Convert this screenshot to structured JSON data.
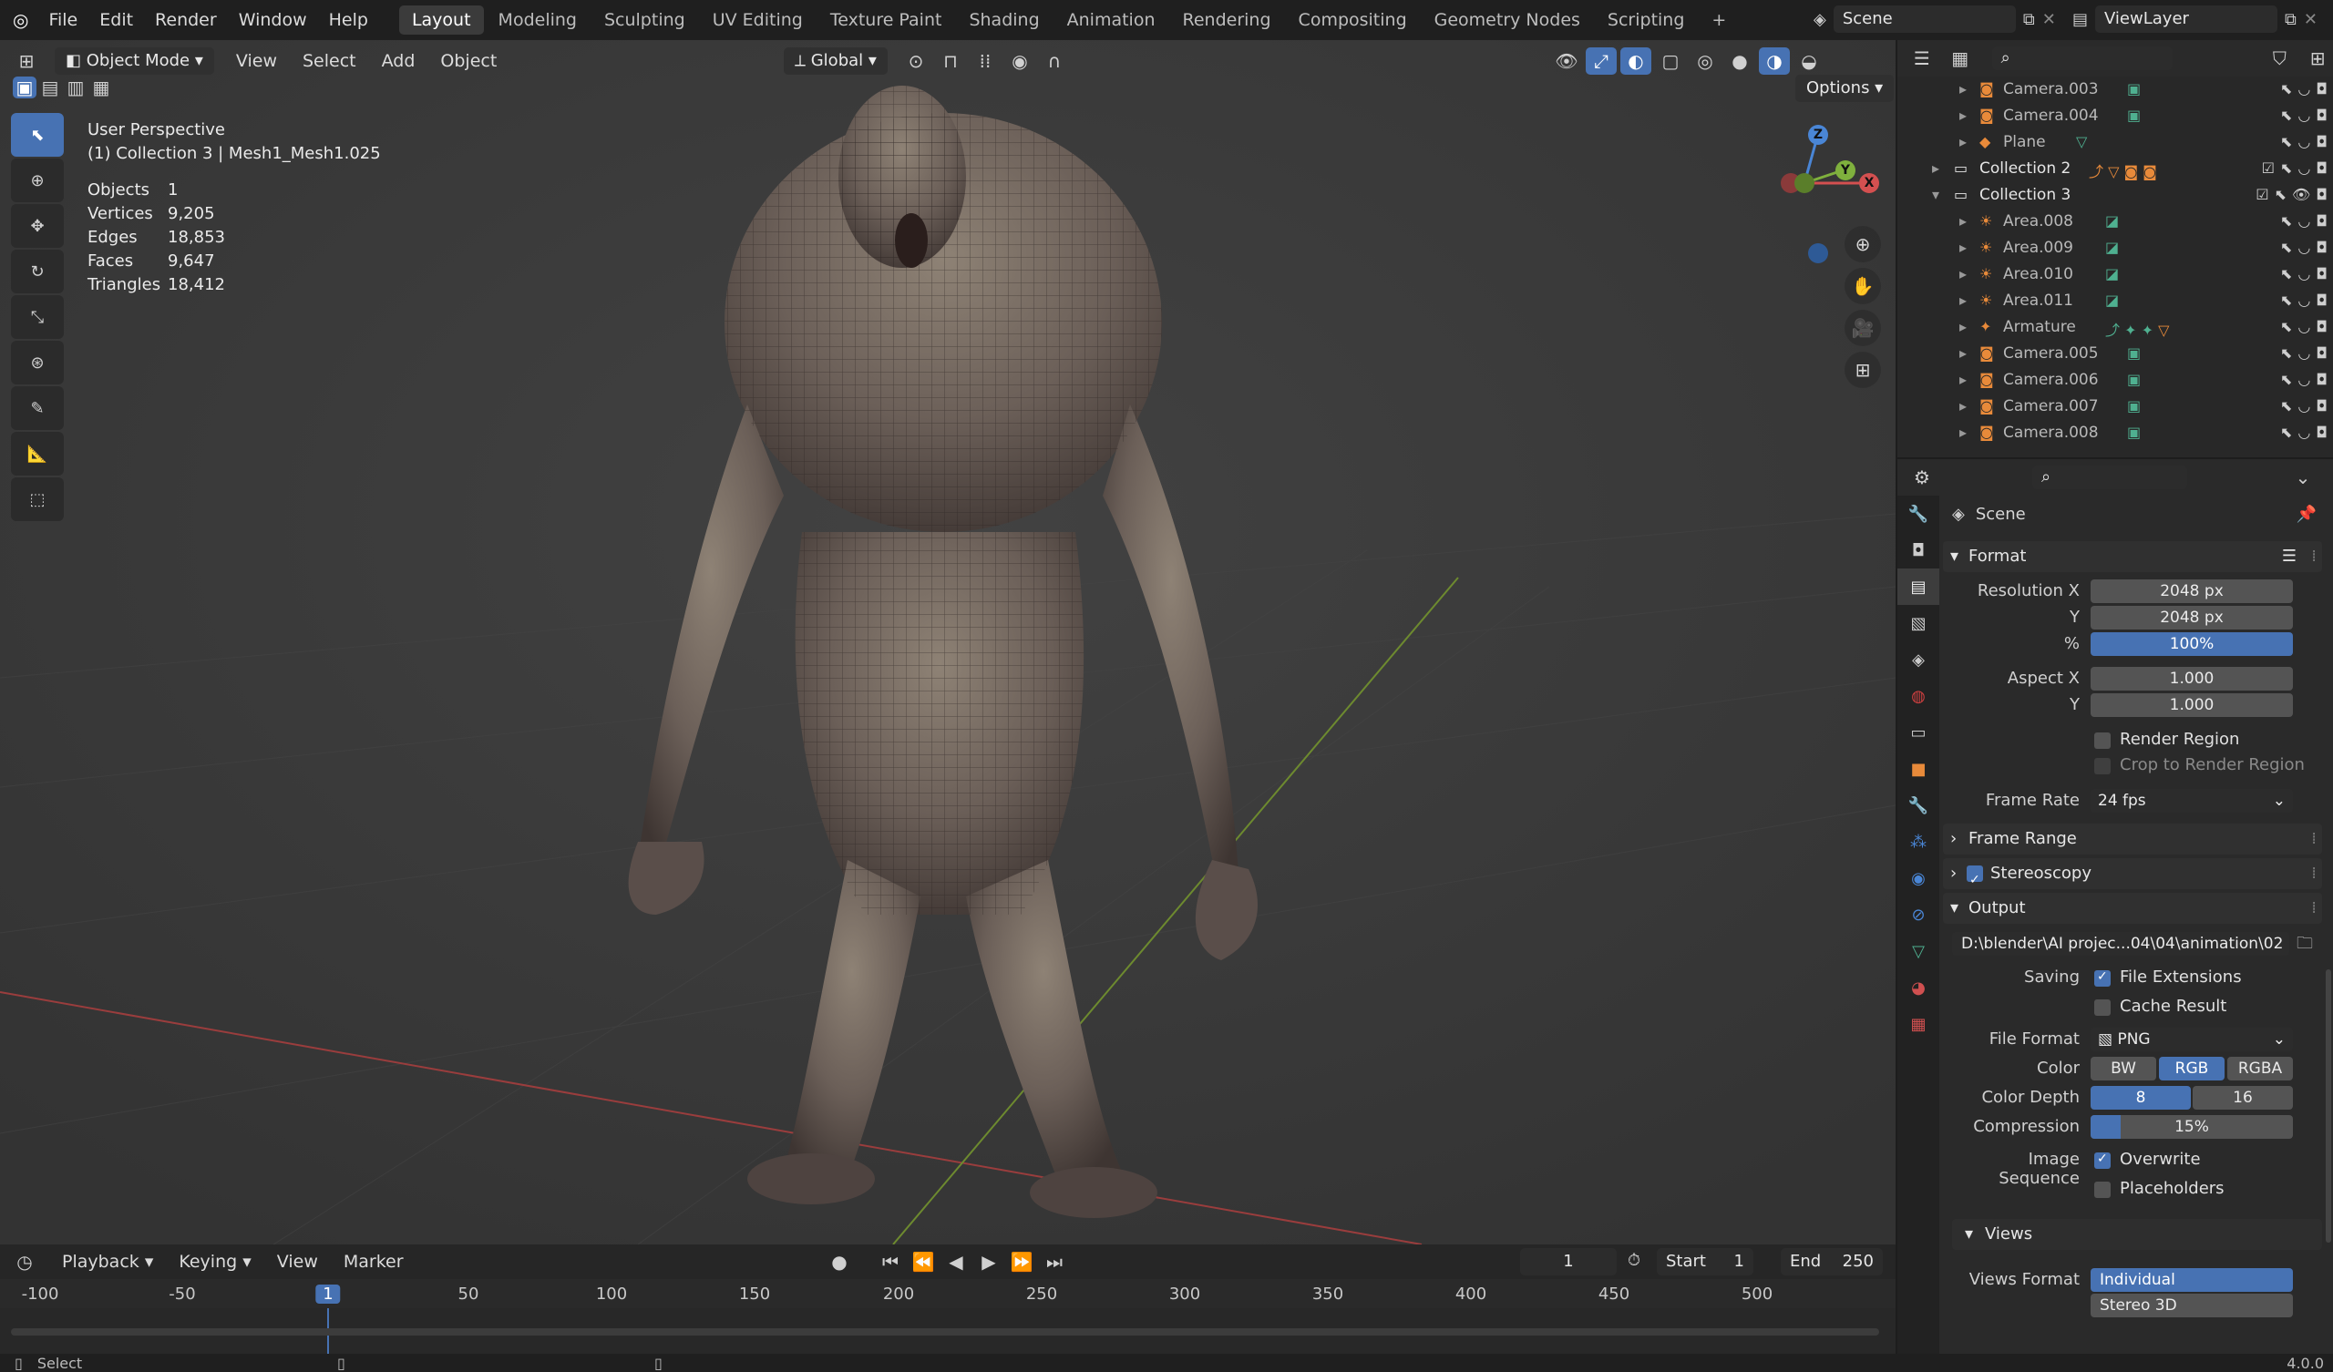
{
  "topbar": {
    "menus": [
      "File",
      "Edit",
      "Render",
      "Window",
      "Help"
    ],
    "workspaces": [
      "Layout",
      "Modeling",
      "Sculpting",
      "UV Editing",
      "Texture Paint",
      "Shading",
      "Animation",
      "Rendering",
      "Compositing",
      "Geometry Nodes",
      "Scripting"
    ],
    "active_workspace": "Layout",
    "scene": "Scene",
    "view_layer": "ViewLayer"
  },
  "viewport": {
    "mode": "Object Mode",
    "menus": [
      "View",
      "Select",
      "Add",
      "Object"
    ],
    "orientation": "Global",
    "options": "Options",
    "view_name": "User Perspective",
    "active_info": "(1) Collection 3 | Mesh1_Mesh1.025",
    "stats": [
      {
        "label": "Objects",
        "value": "1"
      },
      {
        "label": "Vertices",
        "value": "9,205"
      },
      {
        "label": "Edges",
        "value": "18,853"
      },
      {
        "label": "Faces",
        "value": "9,647"
      },
      {
        "label": "Triangles",
        "value": "18,412"
      }
    ],
    "gizmo": {
      "z": "Z",
      "y": "Y",
      "x": "X"
    }
  },
  "timeline": {
    "menus": [
      "Playback",
      "Keying",
      "View",
      "Marker"
    ],
    "current_frame": "1",
    "start_label": "Start",
    "start": "1",
    "end_label": "End",
    "end": "250",
    "ruler": [
      "-100",
      "-50",
      "1",
      "50",
      "100",
      "150",
      "200",
      "250",
      "300",
      "350",
      "400",
      "450",
      "500"
    ]
  },
  "outliner": {
    "rows": [
      {
        "name": "Camera.003",
        "type": "camera",
        "indent": 2
      },
      {
        "name": "Camera.004",
        "type": "camera",
        "indent": 2
      },
      {
        "name": "Plane",
        "type": "mesh",
        "indent": 2
      },
      {
        "name": "Collection 2",
        "type": "collection",
        "indent": 1
      },
      {
        "name": "Collection 3",
        "type": "collection",
        "indent": 1
      },
      {
        "name": "Area.008",
        "type": "light",
        "indent": 2
      },
      {
        "name": "Area.009",
        "type": "light",
        "indent": 2
      },
      {
        "name": "Area.010",
        "type": "light",
        "indent": 2
      },
      {
        "name": "Area.011",
        "type": "light",
        "indent": 2
      },
      {
        "name": "Armature",
        "type": "armature",
        "indent": 2
      },
      {
        "name": "Camera.005",
        "type": "camera",
        "indent": 2
      },
      {
        "name": "Camera.006",
        "type": "camera",
        "indent": 2
      },
      {
        "name": "Camera.007",
        "type": "camera",
        "indent": 2
      },
      {
        "name": "Camera.008",
        "type": "camera",
        "indent": 2
      }
    ]
  },
  "properties": {
    "context": "Scene",
    "format": {
      "title": "Format",
      "resolution_x_label": "Resolution X",
      "resolution_x": "2048 px",
      "resolution_y_label": "Y",
      "resolution_y": "2048 px",
      "percent_label": "%",
      "percent": "100%",
      "aspect_x_label": "Aspect X",
      "aspect_x": "1.000",
      "aspect_y_label": "Y",
      "aspect_y": "1.000",
      "render_region": "Render Region",
      "crop": "Crop to Render Region",
      "frame_rate_label": "Frame Rate",
      "frame_rate": "24 fps"
    },
    "frame_range": "Frame Range",
    "stereoscopy": "Stereoscopy",
    "output": {
      "title": "Output",
      "path": "D:\\blender\\AI projec...04\\04\\animation\\02",
      "saving_label": "Saving",
      "file_extensions": "File Extensions",
      "cache_result": "Cache Result",
      "file_format_label": "File Format",
      "file_format": "PNG",
      "color_label": "Color",
      "color_options": [
        "BW",
        "RGB",
        "RGBA"
      ],
      "color_selected": "RGB",
      "depth_label": "Color Depth",
      "depth_options": [
        "8",
        "16"
      ],
      "depth_selected": "8",
      "compression_label": "Compression",
      "compression": "15%",
      "compression_fraction": 0.15,
      "image_sequence_label": "Image Sequence",
      "overwrite": "Overwrite",
      "placeholders": "Placeholders"
    },
    "views": {
      "title": "Views",
      "format_label": "Views Format",
      "options": [
        "Individual",
        "Stereo 3D"
      ],
      "selected": "Individual"
    }
  },
  "statusbar": {
    "left": "Select",
    "version": "4.0.0"
  }
}
